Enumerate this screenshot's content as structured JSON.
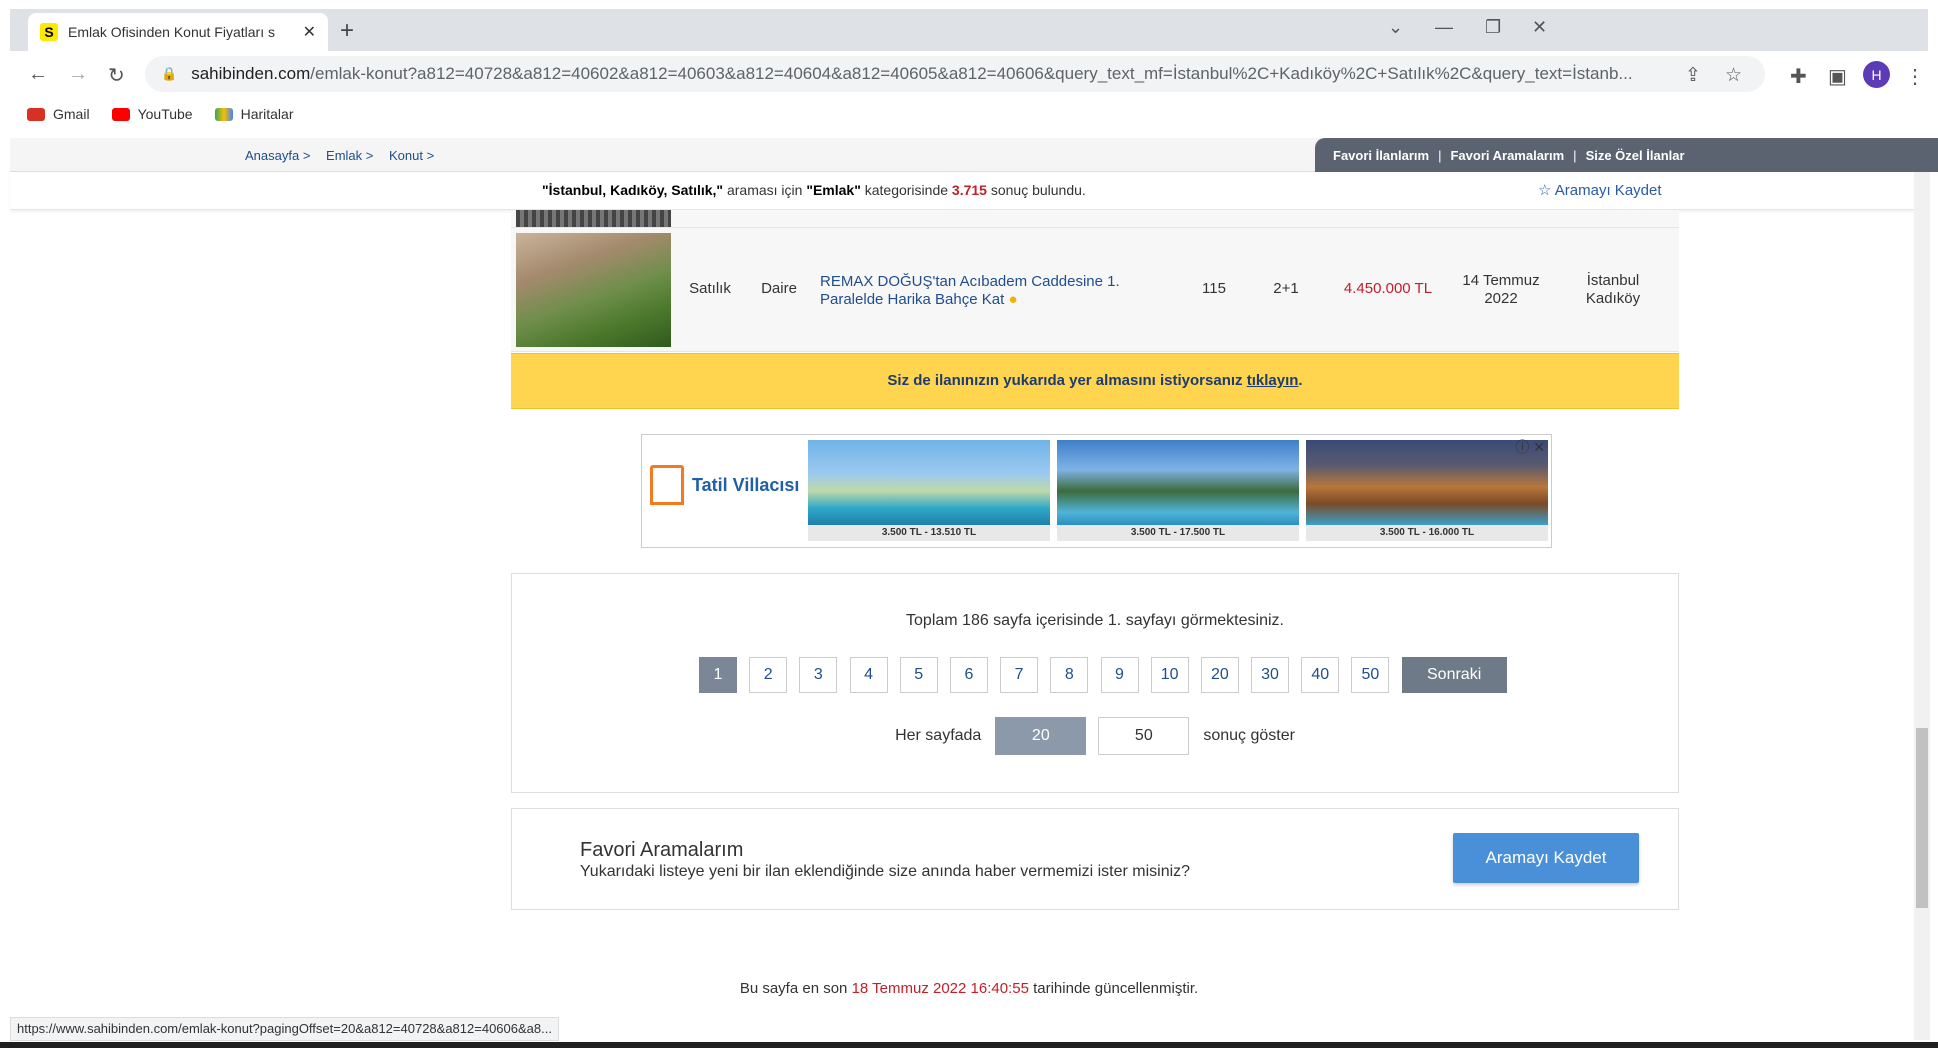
{
  "browser": {
    "tab_title": "Emlak Ofisinden Konut Fiyatları s",
    "favicon_letter": "S",
    "url_host": "sahibinden.com",
    "url_path": "/emlak-konut?a812=40728&a812=40602&a812=40603&a812=40604&a812=40605&a812=40606&query_text_mf=İstanbul%2C+Kadıköy%2C+Satılık%2C&query_text=İstanb...",
    "profile_initial": "H",
    "status_url": "https://www.sahibinden.com/emlak-konut?pagingOffset=20&a812=40728&a812=40606&a8..."
  },
  "bookmarks": [
    {
      "label": "Gmail",
      "icon": "gmail-icon",
      "color": "#d93025"
    },
    {
      "label": "YouTube",
      "icon": "youtube-icon",
      "color": "#ff0000"
    },
    {
      "label": "Haritalar",
      "icon": "maps-icon",
      "color": "#34a853"
    }
  ],
  "site": {
    "breadcrumbs": [
      "Anasayfa >",
      "Emlak >",
      "Konut >"
    ],
    "user_links": [
      "Favori İlanlarım",
      "Favori Aramalarım",
      "Size Özel İlanlar"
    ],
    "result": {
      "query": "\"İstanbul, Kadıköy, Satılık,\"",
      "mid": "araması için",
      "category": "\"Emlak\"",
      "mid2": "kategorisinde",
      "count": "3.715",
      "tail": "sonuç bulundu."
    },
    "save_search_top": "Aramayı Kaydet"
  },
  "listing": {
    "type": "Satılık",
    "kind": "Daire",
    "title": "REMAX DOĞUŞ'tan Acıbadem Caddesine 1. Paralelde Harika Bahçe Kat",
    "m2": "115",
    "rooms": "2+1",
    "price": "4.450.000 TL",
    "date": "14 Temmuz 2022",
    "location": "İstanbul Kadıköy"
  },
  "promo": {
    "text": "Siz de ilanınızın yukarıda yer almasını istiyorsanız",
    "link": "tıklayın",
    "end": "."
  },
  "ad": {
    "brand": "Tatil Villacısı",
    "cards": [
      {
        "price": "3.500 TL - 13.510 TL"
      },
      {
        "price": "3.500 TL - 17.500 TL"
      },
      {
        "price": "3.500 TL - 16.000 TL"
      }
    ]
  },
  "pagination": {
    "info": "Toplam 186 sayfa içerisinde 1. sayfayı görmektesiniz.",
    "pages": [
      "1",
      "2",
      "3",
      "4",
      "5",
      "6",
      "7",
      "8",
      "9",
      "10",
      "20",
      "30",
      "40",
      "50"
    ],
    "next": "Sonraki",
    "per_page_label": "Her sayfada",
    "per_page_options": [
      "20",
      "50"
    ],
    "per_page_suffix": "sonuç göster"
  },
  "favorite": {
    "title": "Favori Aramalarım",
    "desc": "Yukarıdaki listeye yeni bir ilan eklendiğinde size anında haber vermemizi ister misiniz?",
    "button": "Aramayı Kaydet"
  },
  "footer": {
    "prefix": "Bu sayfa en son",
    "datetime": "18 Temmuz 2022 16:40:55",
    "suffix": "tarihinde güncellenmiştir."
  }
}
